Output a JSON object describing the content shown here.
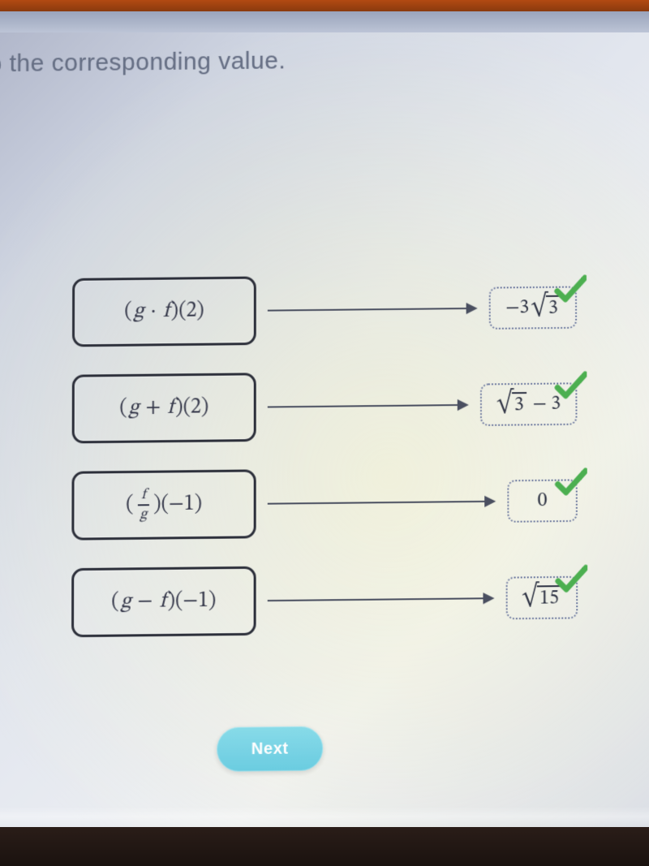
{
  "prompt": "it to the corresponding value.",
  "rows": [
    {
      "expr": "(g · f)(2)",
      "answer": "−3√3"
    },
    {
      "expr": "(g + f)(2)",
      "answer": "√3 − 3"
    },
    {
      "expr": "(f/g)(−1)",
      "answer": "0"
    },
    {
      "expr": "(g − f)(−1)",
      "answer": "√15"
    }
  ],
  "next_label": "Next",
  "all_correct": true
}
